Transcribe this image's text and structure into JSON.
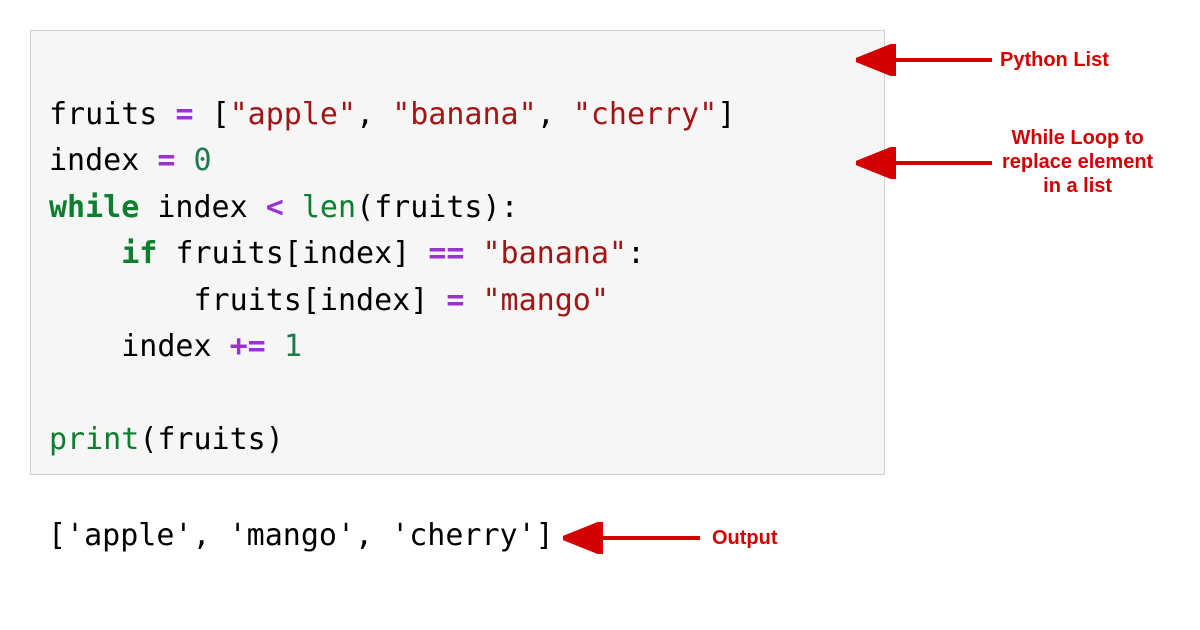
{
  "code": {
    "line1": {
      "t0": "fruits ",
      "eq": "=",
      "t1": " ",
      "lb": "[",
      "s1": "\"apple\"",
      "c1": ", ",
      "s2": "\"banana\"",
      "c2": ", ",
      "s3": "\"cherry\"",
      "rb": "]"
    },
    "line2": {
      "t0": "index ",
      "eq": "=",
      "t1": " ",
      "n0": "0"
    },
    "line3": {
      "kw": "while",
      "t0": " index ",
      "lt": "<",
      "t1": " ",
      "fn": "len",
      "lp": "(fruits):"
    },
    "line4": {
      "indent": "    ",
      "kw": "if",
      "t0": " fruits[index] ",
      "eq": "==",
      "t1": " ",
      "s0": "\"banana\"",
      "colon": ":"
    },
    "line5": {
      "indent": "        ",
      "t0": "fruits[index] ",
      "eq": "=",
      "t1": " ",
      "s0": "\"mango\""
    },
    "line6": {
      "indent": "    ",
      "t0": "index ",
      "op": "+=",
      "t1": " ",
      "n0": "1"
    },
    "line7": {
      "fn": "print",
      "args": "(fruits)"
    }
  },
  "output": "['apple', 'mango', 'cherry']",
  "annotations": {
    "list_label": "Python List",
    "loop_label": "While Loop to\nreplace element\nin a list",
    "output_label": "Output"
  }
}
